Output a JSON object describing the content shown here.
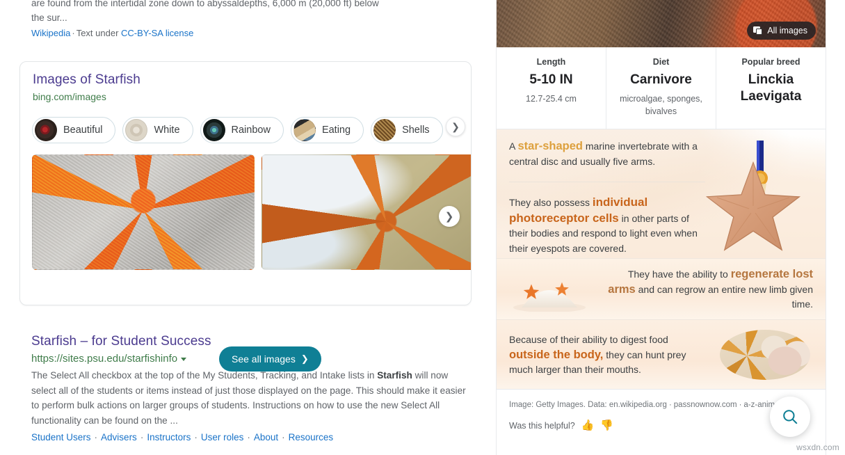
{
  "wiki": {
    "snippet_clipped": "are found from the intertidal zone down to abyssaldepths, 6,000 m (20,000 ft) below",
    "snippet_line2": "the sur...",
    "source": "Wikipedia",
    "separator": "·",
    "license_prefix": "Text under ",
    "license_link": "CC-BY-SA license"
  },
  "images_card": {
    "title": "Images of Starfish",
    "url": "bing.com/images",
    "chips": [
      {
        "label": "Beautiful",
        "thumb_name": "chip-thumb-beautiful"
      },
      {
        "label": "White",
        "thumb_name": "chip-thumb-white"
      },
      {
        "label": "Rainbow",
        "thumb_name": "chip-thumb-rainbow"
      },
      {
        "label": "Eating",
        "thumb_name": "chip-thumb-eating"
      },
      {
        "label": "Shells",
        "thumb_name": "chip-thumb-shells"
      }
    ],
    "chip_next_icon": "chevron-right-icon",
    "thumbnails": [
      {
        "alt": "Orange starfish on grey sand"
      },
      {
        "alt": "Starfish on wet beach with sea foam"
      }
    ],
    "thumb_next_icon": "chevron-right-icon",
    "see_all_label": "See all images",
    "see_all_chevron": "chevron-right-icon",
    "accent_color": "#0f7f95",
    "title_color": "#4b3b8f",
    "url_color": "#3f7c4a"
  },
  "result": {
    "title": "Starfish – for Student Success",
    "url": "https://sites.psu.edu/starfishinfo",
    "url_caret_icon": "caret-down-icon",
    "snippet_parts": [
      {
        "text": "The Select All checkbox at the top of the My Students, Tracking, and Intake lists in ",
        "bold": false
      },
      {
        "text": "Starfish",
        "bold": true
      },
      {
        "text": " will now select all of the students or items instead of just those displayed on the page. This should make it easier to perform bulk actions on larger groups of students. Instructions on how to use the new Select All functionality can be found on the ...",
        "bold": false
      }
    ],
    "sitelinks": [
      "Student Users",
      "Advisers",
      "Instructors",
      "User roles",
      "About",
      "Resources"
    ],
    "sitelink_separator": "·"
  },
  "knowledge_panel": {
    "hero": {
      "badge_label": "All images",
      "badge_icon": "image-stack-icon"
    },
    "facts": [
      {
        "label": "Length",
        "value": "5-10 IN",
        "sub": "12.7-25.4 cm"
      },
      {
        "label": "Diet",
        "value": "Carnivore",
        "sub": "microalgae, sponges, bivalves"
      },
      {
        "label": "Popular breed",
        "value": "Linckia Laevigata",
        "sub": ""
      }
    ],
    "blocks": [
      {
        "id": "block-star-shaped",
        "lead": "A ",
        "highlight": "star-shaped",
        "highlight_color": "#dda03d",
        "tail": " marine invertebrate with a central disc and usually five arms.",
        "art_name": "starfish-medal-illustration"
      },
      {
        "id": "block-photoreceptor",
        "lead": "They also possess ",
        "highlight": "individual photoreceptor cells",
        "highlight_color": "#c8651b",
        "tail": " in other parts of their bodies and respond to light even when their eyespots are covered."
      },
      {
        "id": "block-regenerate",
        "lead": "They have the ability to ",
        "highlight": "regenerate lost arms",
        "highlight_color": "#b5763f",
        "tail": " and can regrow an entire new limb given time.",
        "art_name": "sand-pile-starfish-illustration"
      },
      {
        "id": "block-digest",
        "lead": "Because of their ability to digest food ",
        "highlight": "outside the body,",
        "highlight_color": "#c8651b",
        "tail": " they can hunt prey much larger than their mouths.",
        "art_name": "starfish-shells-photo"
      }
    ],
    "attribution": {
      "image_credit": "Image: Getty Images.",
      "data_prefix": "Data: ",
      "data_sources": [
        "en.wikipedia.org",
        "passnownow.com",
        "a-z-animals.com"
      ],
      "separator": "·"
    },
    "feedback": {
      "question": "Was this helpful?",
      "thumbs_up_icon": "thumbs-up-icon",
      "thumbs_down_icon": "thumbs-down-icon"
    },
    "fab": {
      "icon": "search-icon",
      "color": "#0f7f95"
    }
  },
  "watermark": "wsxdn.com"
}
